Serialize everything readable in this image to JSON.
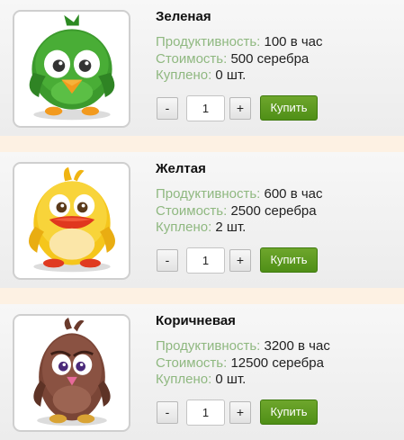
{
  "items": [
    {
      "name": "Зеленая",
      "productivity_label": "Продуктивность:",
      "productivity_value": "100 в час",
      "cost_label": "Стоимость:",
      "cost_value": "500 серебра",
      "bought_label": "Куплено:",
      "bought_value": "0 шт.",
      "minus_label": "-",
      "plus_label": "+",
      "quantity": "1",
      "buy_label": "Купить",
      "image": "green-bird-icon",
      "color": "#3c9a2d"
    },
    {
      "name": "Желтая",
      "productivity_label": "Продуктивность:",
      "productivity_value": "600 в час",
      "cost_label": "Стоимость:",
      "cost_value": "2500 серебра",
      "bought_label": "Куплено:",
      "bought_value": "2 шт.",
      "minus_label": "-",
      "plus_label": "+",
      "quantity": "1",
      "buy_label": "Купить",
      "image": "yellow-bird-icon",
      "color": "#f2c01a"
    },
    {
      "name": "Коричневая",
      "productivity_label": "Продуктивность:",
      "productivity_value": "3200 в час",
      "cost_label": "Стоимость:",
      "cost_value": "12500 серебра",
      "bought_label": "Куплено:",
      "bought_value": "0 шт.",
      "minus_label": "-",
      "plus_label": "+",
      "quantity": "1",
      "buy_label": "Купить",
      "image": "brown-bird-icon",
      "color": "#7a4536"
    }
  ],
  "colors": {
    "page_background": "#fdf1e3",
    "label_text": "#8fb880",
    "buy_button": "#5a9a1f"
  }
}
